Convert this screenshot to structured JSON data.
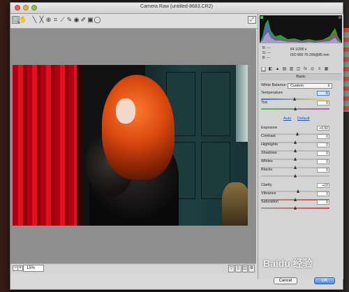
{
  "window": {
    "title": "Camera Raw (untitled-8683.CR2)"
  },
  "toolbar": {
    "tools": [
      {
        "icon": "zoom-icon",
        "glyph": "🔍"
      },
      {
        "icon": "hand-icon",
        "glyph": "✋"
      },
      {
        "icon": "white-balance-icon",
        "glyph": "╲"
      },
      {
        "icon": "color-sampler-icon",
        "glyph": "╳"
      },
      {
        "icon": "target-adjust-icon",
        "glyph": "⊕"
      },
      {
        "icon": "crop-icon",
        "glyph": "⌗"
      },
      {
        "icon": "straighten-icon",
        "glyph": "⟋"
      },
      {
        "icon": "spot-removal-icon",
        "glyph": "✎"
      },
      {
        "icon": "red-eye-icon",
        "glyph": "◉"
      },
      {
        "icon": "adjustment-brush-icon",
        "glyph": "✐"
      },
      {
        "icon": "graduated-filter-icon",
        "glyph": "▣"
      },
      {
        "icon": "radial-filter-icon",
        "glyph": "◯"
      }
    ],
    "right_glyph": "⤢"
  },
  "exif": {
    "r": "R: ---",
    "g": "G: ---",
    "b": "B: ---",
    "line1": "f/4   1/200 s",
    "line2": "ISO 800   70-200@85 mm"
  },
  "panel": {
    "section_title": "Basic",
    "white_balance_label": "White Balance:",
    "white_balance_value": "Custom",
    "auto": "Auto",
    "default": "Default",
    "sliders": [
      {
        "label": "Temperature",
        "value": "-5",
        "pos": 0.49,
        "focused": true
      },
      {
        "label": "Tint",
        "value": "0",
        "pos": 0.5
      },
      {
        "label": "Exposure",
        "value": "+0.50",
        "pos": 0.54
      },
      {
        "label": "Contrast",
        "value": "0",
        "pos": 0.5
      },
      {
        "label": "Highlights",
        "value": "0",
        "pos": 0.5
      },
      {
        "label": "Shadows",
        "value": "0",
        "pos": 0.5
      },
      {
        "label": "Whites",
        "value": "0",
        "pos": 0.5
      },
      {
        "label": "Blacks",
        "value": "0",
        "pos": 0.5
      },
      {
        "label": "Clarity",
        "value": "+10",
        "pos": 0.55
      },
      {
        "label": "Vibrance",
        "value": "0",
        "pos": 0.5
      },
      {
        "label": "Saturation",
        "value": "0",
        "pos": 0.5
      }
    ]
  },
  "status": {
    "zoom": "15%",
    "zoom_out": "−",
    "zoom_in": "+"
  },
  "buttons": {
    "cancel": "Cancel",
    "ok": "OK"
  },
  "watermark": "Baidu 经验"
}
